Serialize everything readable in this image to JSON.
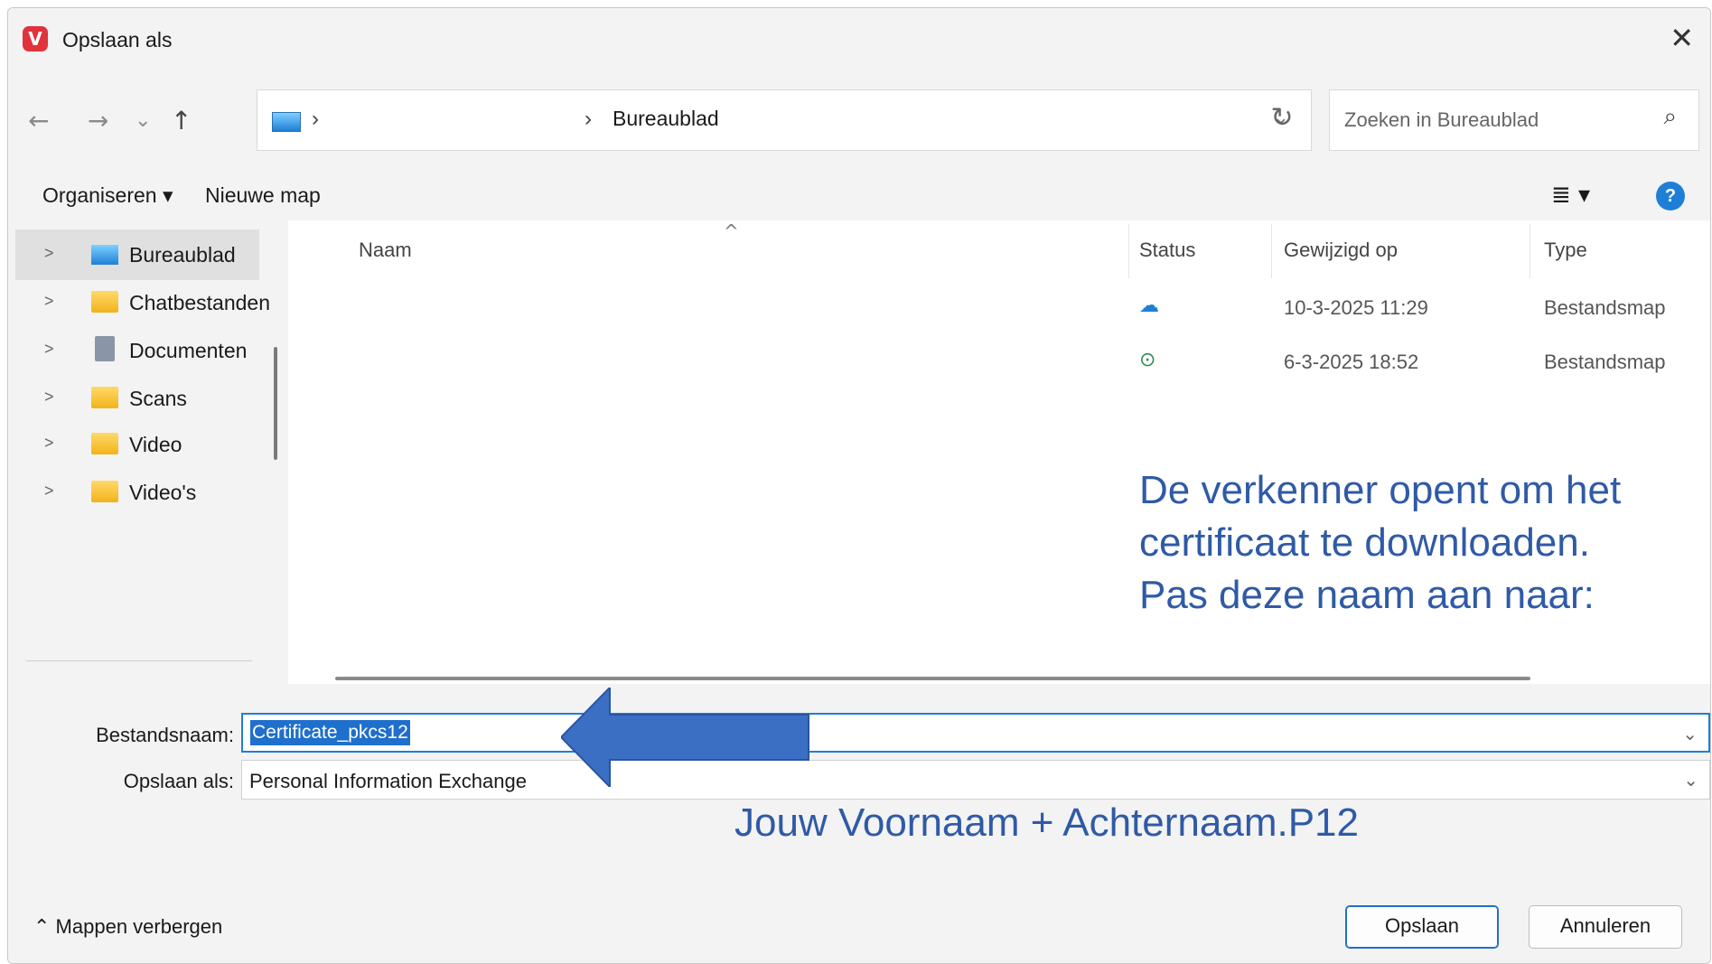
{
  "window": {
    "title": "Opslaan als",
    "close_glyph": "✕"
  },
  "nav": {
    "back": "←",
    "forward": "→",
    "recent": "⌄",
    "up": "↑",
    "address_sep": "›",
    "address_location": "Bureaublad",
    "address_dropdown": "⌄",
    "refresh": "↻",
    "search_placeholder": "Zoeken in Bureaublad",
    "search_icon": "⌕"
  },
  "toolbar": {
    "organize": "Organiseren ▾",
    "new_folder": "Nieuwe map",
    "view": "≣ ▾",
    "help": "?"
  },
  "sidebar": {
    "items": [
      {
        "label": "Bureaublad",
        "icon": "desktop-icon"
      },
      {
        "label": "Chatbestanden",
        "icon": "folder-icon"
      },
      {
        "label": "Documenten",
        "icon": "documents-icon"
      },
      {
        "label": "Scans",
        "icon": "folder-icon"
      },
      {
        "label": "Video",
        "icon": "folder-icon"
      },
      {
        "label": "Video's",
        "icon": "folder-icon"
      }
    ]
  },
  "columns": {
    "name": "Naam",
    "status": "Status",
    "modified": "Gewijzigd op",
    "type": "Type",
    "sort_glyph": "^"
  },
  "rows": [
    {
      "status_icon": "cloud-icon",
      "status_glyph": "☁",
      "modified": "10-3-2025 11:29",
      "type": "Bestandsmap"
    },
    {
      "status_icon": "check-circle-icon",
      "status_glyph": "⊙",
      "modified": "6-3-2025 18:52",
      "type": "Bestandsmap"
    }
  ],
  "annotation": {
    "line1": "De verkenner opent om het",
    "line2": "certificaat te downloaden.",
    "line3": "Pas deze naam aan naar:",
    "hint": "Jouw Voornaam + Achternaam.P12",
    "color": "#2f5aa6"
  },
  "form": {
    "filename_label": "Bestandsnaam:",
    "filename_value": "Certificate_pkcs12",
    "type_label": "Opslaan als:",
    "type_value": "Personal Information Exchange",
    "dropdown_glyph": "⌄"
  },
  "footer": {
    "hide_folders": "⌃  Mappen verbergen",
    "save": "Opslaan",
    "cancel": "Annuleren"
  },
  "colors": {
    "accent": "#1f6fcc",
    "arrow": "#3a6fc4",
    "app_icon": "#e0333b"
  }
}
